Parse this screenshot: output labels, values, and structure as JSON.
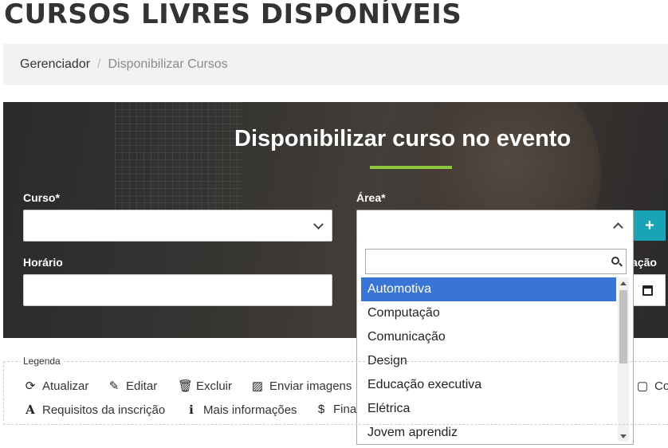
{
  "page": {
    "title": "CURSOS LIVRES DISPONÍVEIS"
  },
  "breadcrumb": {
    "home": "Gerenciador",
    "separator": "/",
    "current": "Disponibilizar Cursos"
  },
  "form": {
    "heading": "Disponibilizar curso no evento",
    "curso_label": "Curso*",
    "area_label": "Área*",
    "horario_label": "Horário",
    "data_label_partial": "ação",
    "add_label": "+"
  },
  "area_dropdown": {
    "search_value": "",
    "options": [
      "Automotiva",
      "Computação",
      "Comunicação",
      "Design",
      "Educação executiva",
      "Elétrica",
      "Jovem aprendiz"
    ],
    "selected": "Automotiva"
  },
  "legend": {
    "title": "Legenda",
    "items": [
      {
        "label": "Atualizar",
        "icon": "refresh-icon"
      },
      {
        "label": "Editar",
        "icon": "edit-icon"
      },
      {
        "label": "Excluir",
        "icon": "trash-icon"
      },
      {
        "label": "Enviar imagens",
        "icon": "image-icon"
      },
      {
        "label": "Conte",
        "icon": "content-icon"
      },
      {
        "label": "Requisitos da inscrição",
        "icon": "font-icon"
      },
      {
        "label": "Mais informações",
        "icon": "info-icon"
      },
      {
        "label": "Fina",
        "icon": "dollar-icon"
      }
    ]
  },
  "colors": {
    "accent_green": "#8cc63f",
    "add_button": "#1aa3b5",
    "selected_option": "#3875d7"
  }
}
